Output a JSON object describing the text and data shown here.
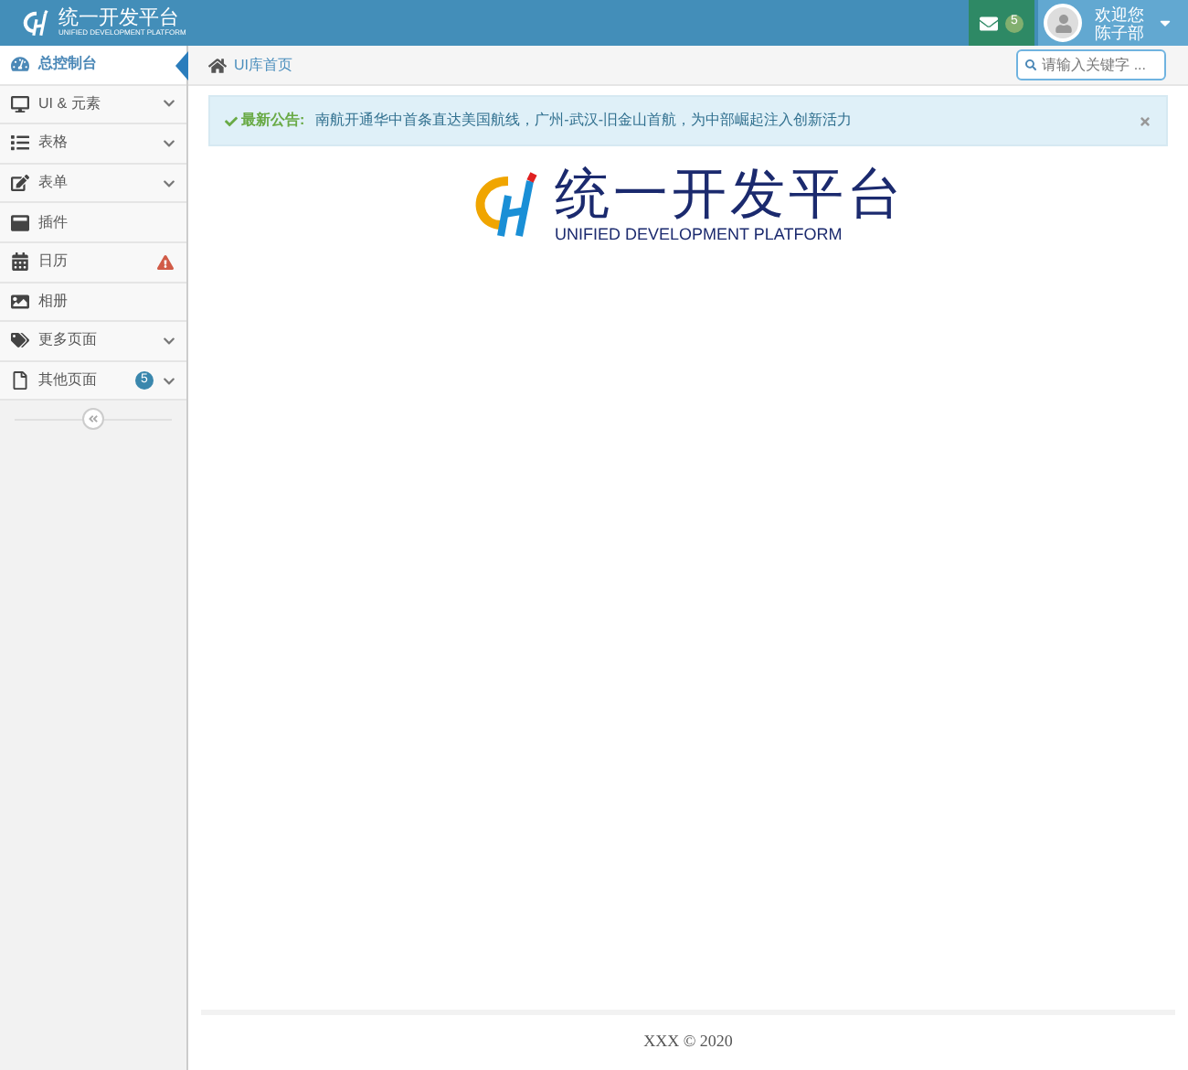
{
  "header": {
    "brand": "统一开发平台",
    "brand_sub": "UNIFIED DEVELOPMENT PLATFORM",
    "mail_count": "5",
    "welcome": "欢迎您",
    "user": "陈子部"
  },
  "sidebar": {
    "items": [
      {
        "label": "总控制台",
        "kind": "plain",
        "selected": true
      },
      {
        "label": "UI & 元素",
        "kind": "arrow",
        "selected": false
      },
      {
        "label": "表格",
        "kind": "arrow",
        "selected": false
      },
      {
        "label": "表单",
        "kind": "arrow",
        "selected": false
      },
      {
        "label": "插件",
        "kind": "plain",
        "selected": false
      },
      {
        "label": "日历",
        "kind": "warning",
        "selected": false
      },
      {
        "label": "相册",
        "kind": "plain",
        "selected": false
      },
      {
        "label": "更多页面",
        "kind": "arrow",
        "selected": false
      },
      {
        "label": "其他页面",
        "kind": "badge",
        "badge": "5",
        "selected": false
      }
    ]
  },
  "breadcrumb": "UI库首页",
  "search": {
    "placeholder": "请输入关键字 ..."
  },
  "alert": {
    "title": "最新公告:",
    "text": "南航开通华中首条直达美国航线，广州-武汉-旧金山首航，为中部崛起注入创新活力"
  },
  "logo": {
    "title": "统一开发平台",
    "subtitle": "UNIFIED DEVELOPMENT PLATFORM"
  },
  "footer": "XXX © 2020"
}
